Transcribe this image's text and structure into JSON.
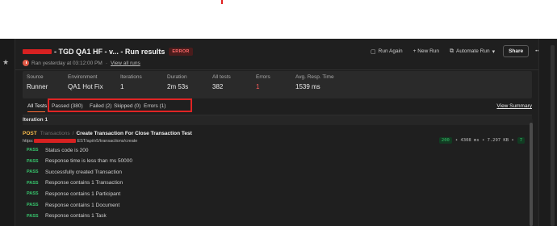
{
  "header": {
    "title": " - TGD QA1 HF - v... - Run results",
    "status_badge": "ERROR",
    "ran_text": "Ran yesterday at 03:12:00 PM",
    "separator": "·",
    "view_all_runs": "View all runs"
  },
  "actions": {
    "run_again": "Run Again",
    "new_run": "+ New Run",
    "automate_run": "Automate Run",
    "share": "Share",
    "more": "•••"
  },
  "stats": {
    "source": {
      "label": "Source",
      "value": "Runner"
    },
    "environment": {
      "label": "Environment",
      "value": "QA1 Hot Fix"
    },
    "iterations": {
      "label": "Iterations",
      "value": "1"
    },
    "duration": {
      "label": "Duration",
      "value": "2m 53s"
    },
    "all_tests": {
      "label": "All tests",
      "value": "382"
    },
    "errors": {
      "label": "Errors",
      "value": "1"
    },
    "avg_resp": {
      "label": "Avg. Resp. Time",
      "value": "1539 ms"
    }
  },
  "tabs": {
    "all": "All Tests",
    "passed": "Passed (380)",
    "failed": "Failed (2)",
    "skipped": "Skipped (0)",
    "errors": "Errors (1)",
    "view_summary": "View Summary"
  },
  "iteration": {
    "heading": "Iteration 1",
    "request": {
      "method": "POST",
      "folder": "Transactions",
      "slash": "/",
      "name": "Create Transaction For Close Transaction Test",
      "url_prefix": "https:",
      "url_suffix": "EST/api/v5/transactions/create",
      "status_code": "200",
      "meta": "• 4308 ms • 7.297 KB •",
      "pass_count": "7"
    },
    "assertions": [
      {
        "badge": "PASS",
        "text": "Status code is 200"
      },
      {
        "badge": "PASS",
        "text": "Response time is less than ms 50000"
      },
      {
        "badge": "PASS",
        "text": "Successfully created Transaction"
      },
      {
        "badge": "PASS",
        "text": "Response contains 1 Transaction"
      },
      {
        "badge": "PASS",
        "text": "Response contains 1 Participant"
      },
      {
        "badge": "PASS",
        "text": "Response contains 1 Document"
      },
      {
        "badge": "PASS",
        "text": "Response contains 1 Task"
      }
    ]
  },
  "colors": {
    "accent": "#ff6c37",
    "error": "#ff5c5c",
    "pass": "#37c46c",
    "annotation": "#e02424",
    "method_post": "#f2b84b"
  },
  "icons": {
    "run_again": "run-again-icon",
    "automate": "automate-icon",
    "star": "star-icon",
    "clock": "run-status-icon"
  }
}
